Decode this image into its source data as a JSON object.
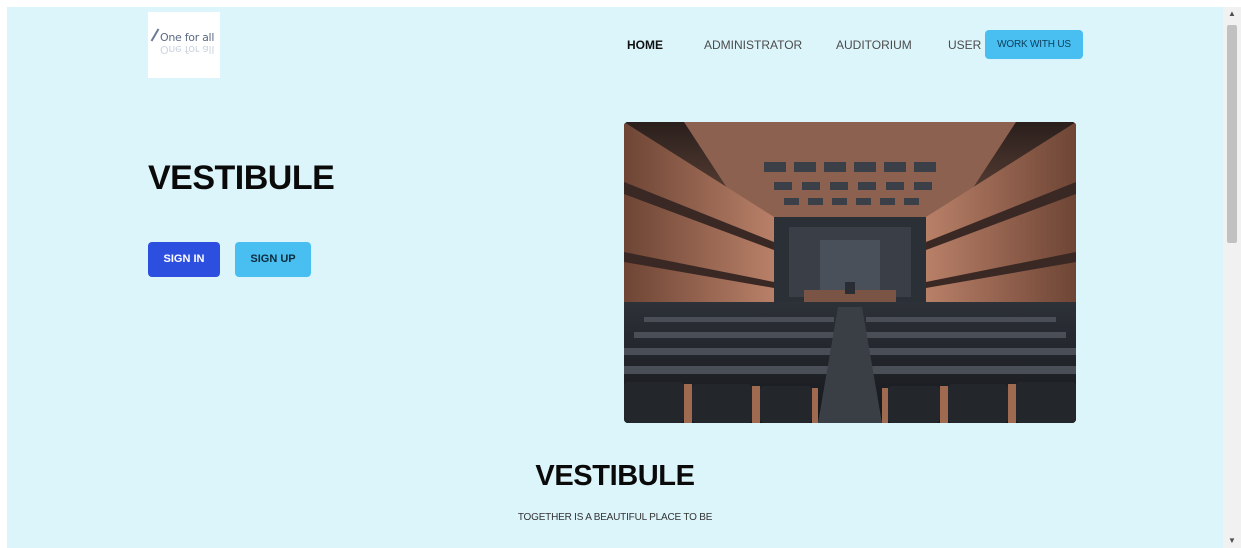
{
  "logo": {
    "text": "One for all",
    "reflection": "One for all"
  },
  "nav": {
    "home": "HOME",
    "administrator": "ADMINISTRATOR",
    "auditorium": "AUDITORIUM",
    "user": "USER",
    "work_with_us": "WORK WITH US"
  },
  "hero": {
    "title": "VESTIBULE",
    "sign_in": "SIGN IN",
    "sign_up": "SIGN UP",
    "image_alt": "auditorium-photo"
  },
  "section": {
    "title": "VESTIBULE",
    "subtitle": "TOGETHER IS A BEAUTIFUL PLACE TO BE"
  },
  "colors": {
    "page_bg": "#dcf5fb",
    "primary": "#2d4fe0",
    "accent": "#48bff0"
  }
}
